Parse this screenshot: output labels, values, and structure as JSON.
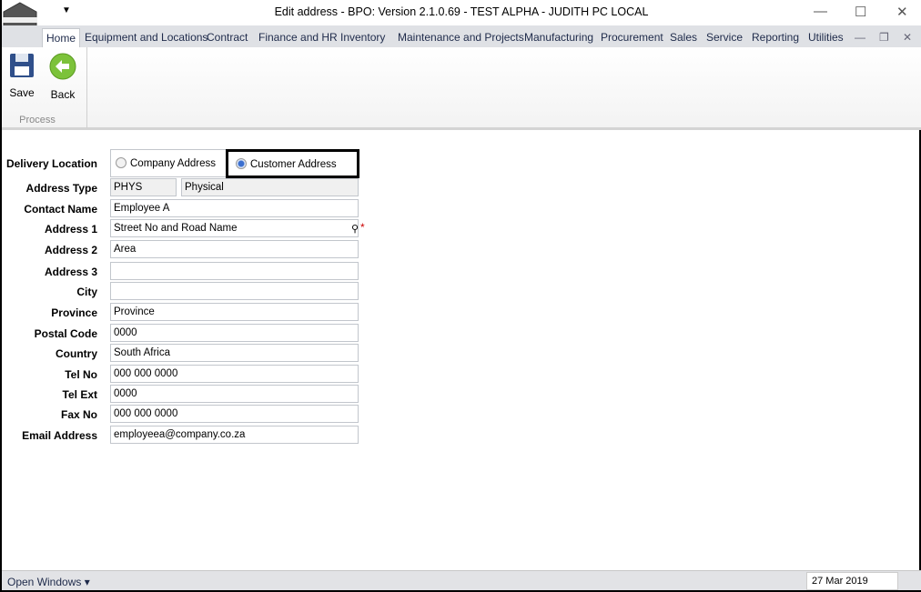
{
  "window": {
    "title": "Edit address - BPO: Version 2.1.0.69 - TEST ALPHA - JUDITH PC LOCAL",
    "logo_text": "BPO"
  },
  "tabs": [
    "Home",
    "Equipment and Locations",
    "Contract",
    "Finance and HR",
    "Inventory",
    "Maintenance and Projects",
    "Manufacturing",
    "Procurement",
    "Sales",
    "Service",
    "Reporting",
    "Utilities"
  ],
  "ribbon": {
    "save": "Save",
    "back": "Back",
    "group": "Process"
  },
  "form": {
    "delivery_label": "Delivery Location",
    "company_address": "Company Address",
    "customer_address": "Customer Address",
    "selected": "Customer Address",
    "address_type_label": "Address Type",
    "address_type_code": "PHYS",
    "address_type_desc": "Physical",
    "required_marker": "*",
    "fields": [
      {
        "label": "Contact Name",
        "value": "Employee A"
      },
      {
        "label": "Address 1",
        "value": "Street No and Road Name"
      },
      {
        "label": "Address 2",
        "value": "Area"
      },
      {
        "label": "Address 3",
        "value": ""
      },
      {
        "label": "City",
        "value": ""
      },
      {
        "label": "Province",
        "value": "Province"
      },
      {
        "label": "Postal Code",
        "value": "0000"
      },
      {
        "label": "Country",
        "value": "South Africa"
      },
      {
        "label": "Tel No",
        "value": "000 000 0000"
      },
      {
        "label": "Tel Ext",
        "value": "0000"
      },
      {
        "label": "Fax No",
        "value": "000 000 0000"
      },
      {
        "label": "Email Address",
        "value": "employeea@company.co.za"
      }
    ]
  },
  "status": {
    "open_windows": "Open Windows ▾",
    "date": "27 Mar 2019"
  }
}
